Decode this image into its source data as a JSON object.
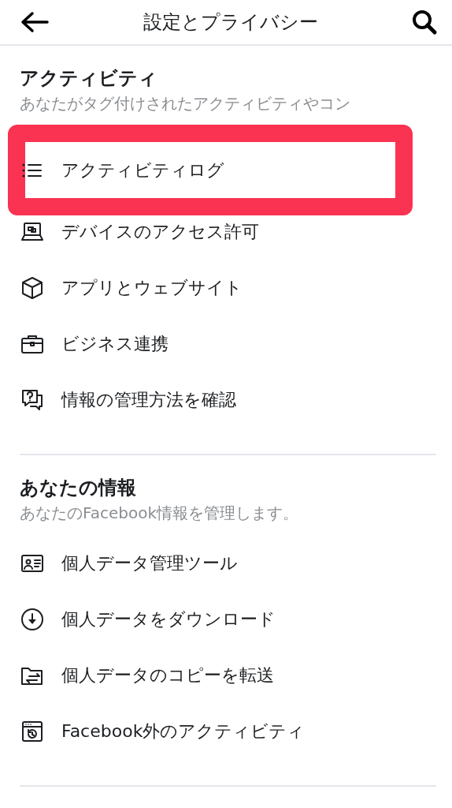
{
  "header": {
    "title": "設定とプライバシー"
  },
  "sections": [
    {
      "title": "アクティビティ",
      "subtitle": "あなたがタグ付けされたアクティビティやコン",
      "items": [
        {
          "label": "アクティビティログ",
          "highlighted": true
        },
        {
          "label": "デバイスのアクセス許可",
          "highlighted": false
        },
        {
          "label": "アプリとウェブサイト",
          "highlighted": false
        },
        {
          "label": "ビジネス連携",
          "highlighted": false
        },
        {
          "label": "情報の管理方法を確認",
          "highlighted": false
        }
      ]
    },
    {
      "title": "あなたの情報",
      "subtitle": "あなたのFacebook情報を管理します。",
      "items": [
        {
          "label": "個人データ管理ツール",
          "highlighted": false
        },
        {
          "label": "個人データをダウンロード",
          "highlighted": false
        },
        {
          "label": "個人データのコピーを転送",
          "highlighted": false
        },
        {
          "label": "Facebook外のアクティビティ",
          "highlighted": false
        }
      ]
    }
  ]
}
